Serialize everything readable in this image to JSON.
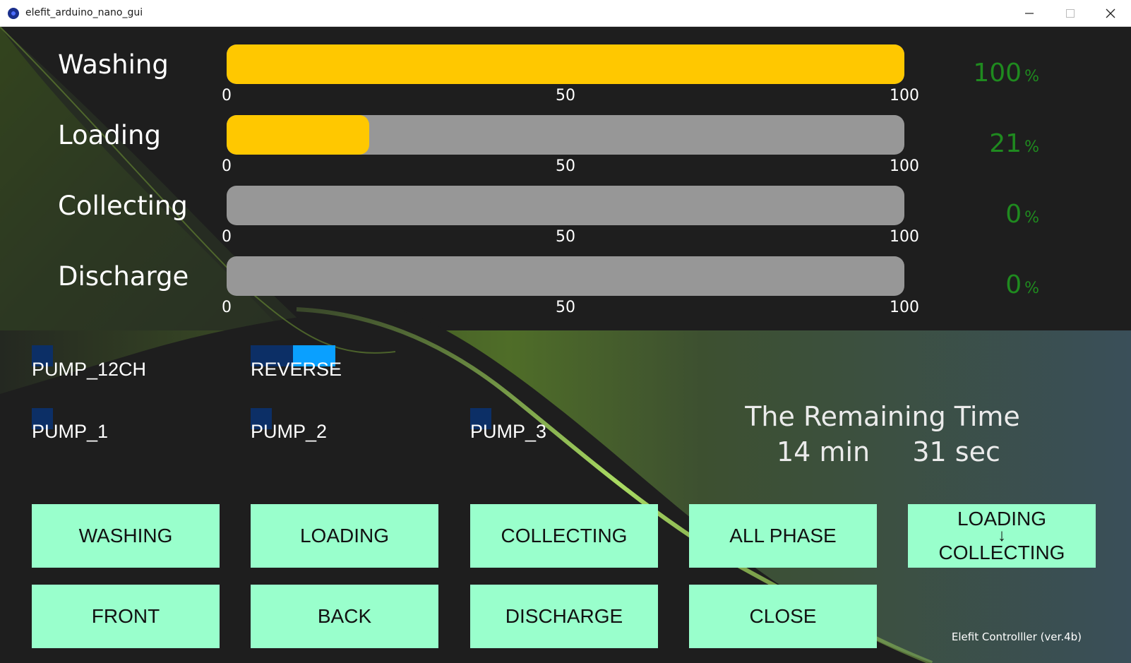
{
  "window": {
    "title": "elefit_arduino_nano_gui",
    "minimize_icon": "minimize-icon",
    "maximize_icon": "maximize-icon",
    "close_icon": "close-icon"
  },
  "phases": [
    {
      "label": "Washing",
      "percent": 100,
      "unit": "%",
      "ticks": [
        "0",
        "50",
        "100"
      ]
    },
    {
      "label": "Loading",
      "percent": 21,
      "unit": "%",
      "ticks": [
        "0",
        "50",
        "100"
      ]
    },
    {
      "label": "Collecting",
      "percent": 0,
      "unit": "%",
      "ticks": [
        "0",
        "50",
        "100"
      ]
    },
    {
      "label": "Discharge",
      "percent": 0,
      "unit": "%",
      "ticks": [
        "0",
        "50",
        "100"
      ]
    }
  ],
  "indicators": {
    "pump_12ch": "PUMP_12CH",
    "reverse": "REVERSE",
    "pump_1": "PUMP_1",
    "pump_2": "PUMP_2",
    "pump_3": "PUMP_3"
  },
  "remaining": {
    "title": "The Remaining Time",
    "minutes": "14",
    "min_unit": "min",
    "seconds": "31",
    "sec_unit": "sec"
  },
  "buttons": {
    "washing": "WASHING",
    "loading": "LOADING",
    "collecting": "COLLECTING",
    "all_phase": "ALL PHASE",
    "loading_collecting_top": "LOADING",
    "loading_collecting_arrow": "↓",
    "loading_collecting_bottom": "COLLECTING",
    "front": "FRONT",
    "back": "BACK",
    "discharge": "DISCHARGE",
    "close": "CLOSE"
  },
  "footer": {
    "version": "Elefit Controlller (ver.4b)"
  },
  "colors": {
    "bar_fill": "#ffc800",
    "bar_track": "#979797",
    "percent_text": "#1f8a1f",
    "button_bg": "#99ffcc",
    "indicator_off": "#0c2f66",
    "indicator_on": "#0aa0ff"
  }
}
